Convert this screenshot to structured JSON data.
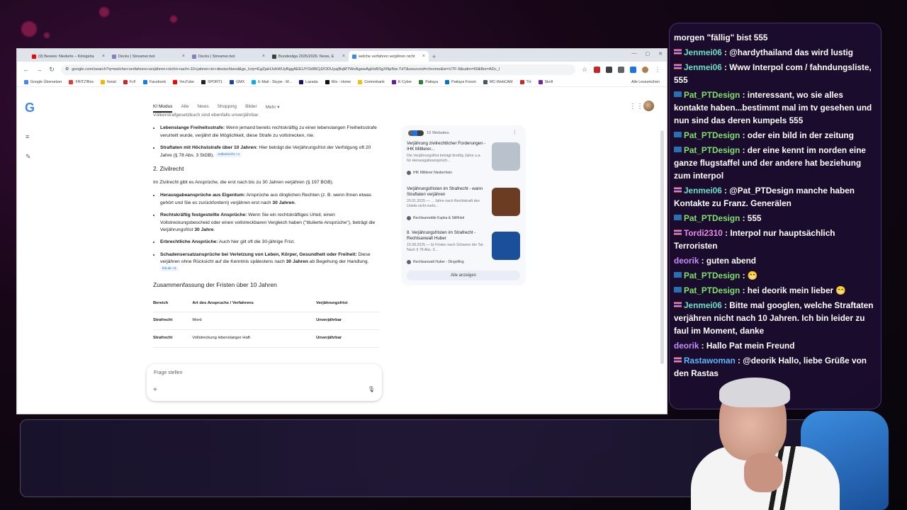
{
  "browser": {
    "tabs": [
      {
        "label": "(9) Beweis: Niederle – Königsha",
        "color": "#ff0000"
      },
      {
        "label": "Decks | Streamer.bot",
        "color": "#8e7cc3"
      },
      {
        "label": "Decks | Streamer.bot",
        "color": "#8e7cc3"
      },
      {
        "label": "Bundesliga 2025/2026: News, E",
        "color": "#3c4043"
      },
      {
        "label": "welche verfahren verjähren nicht",
        "color": "#4285f4"
      }
    ],
    "url": "google.com/search?q=welche+verfahren+verjähren+nicht+nach+10+jahren+in+deutschland&gs_lcrp=EgZjaHJvbWUyBggAEEUYOdIBCjI2ODUyajBqMTWoAgewAgHxBSgXNpNw-TdT&sourceid=chrome&ie=UTF-8&udm=50&fbs=ADc_l",
    "bookmarks": [
      {
        "label": "Google Übersetzer",
        "color": "#4285f4"
      },
      {
        "label": "FRITZ!Box",
        "color": "#e53935"
      },
      {
        "label": "fonial",
        "color": "#f4b400"
      },
      {
        "label": "FcF",
        "color": "#c62828"
      },
      {
        "label": "Facebook",
        "color": "#1877f2"
      },
      {
        "label": "YouTube",
        "color": "#ff0000"
      },
      {
        "label": "SPORT1",
        "color": "#222222"
      },
      {
        "label": "GMX",
        "color": "#1c449b"
      },
      {
        "label": "E-Mail - Skype - M...",
        "color": "#00aff0"
      },
      {
        "label": "Lazada",
        "color": "#0f146d"
      },
      {
        "label": "Wix - Home",
        "color": "#111111"
      },
      {
        "label": "Comonbank",
        "color": "#f6c000"
      },
      {
        "label": "K-Cyber",
        "color": "#6a1b9a"
      },
      {
        "label": "Pattaya",
        "color": "#2e7d32"
      },
      {
        "label": "Pattaya Forum",
        "color": "#0277bd"
      },
      {
        "label": "MC-WebCAM",
        "color": "#455a64"
      },
      {
        "label": "TH",
        "color": "#c62828"
      },
      {
        "label": "Skrill",
        "color": "#7b1fa2"
      }
    ],
    "bookmarks_all": "Alle Lesezeichen"
  },
  "google": {
    "logo": "G",
    "nav": [
      "KI Modus",
      "Alle",
      "News",
      "Shopping",
      "Bilder",
      "Mehr ▾"
    ],
    "top_fragment": "Völkerstrafgesetzbuch sind ebenfalls unverjährbar.",
    "criminal_items": [
      {
        "bold": "Lebenslange Freiheitsstrafe:",
        "text": " Wenn jemand bereits rechtskräftig zu einer lebenslangen Freiheitsstrafe verurteilt wurde, verjährt die Möglichkeit, diese Strafe zu vollstrecken, nie."
      },
      {
        "bold": "Straftaten mit Höchststrafe über 10 Jahren:",
        "text": " Hier beträgt die Verjährungsfrist der Verfolgung oft 20 Jahre (§ 78 Abs. 3 StGB).",
        "chip": "Artikelrecht +4"
      }
    ],
    "civil_heading": "2. Zivilrecht",
    "civil_intro": "Im Zivilrecht gibt es Ansprüche, die erst nach bis zu 30 Jahren verjähren (§ 197 BGB).",
    "civil_items": [
      {
        "bold": "Herausgabeansprüche aus Eigentum:",
        "text": " Ansprüche aus dinglichen Rechten (z. B. wenn Ihnen etwas gehört und Sie es zurückfordern) verjähren erst nach ",
        "bold2": "30 Jahren",
        "tail": "."
      },
      {
        "bold": "Rechtskräftig festgestellte Ansprüche:",
        "text": " Wenn Sie ein rechtskräftiges Urteil, einen Vollstreckungsbescheid oder einen vollstreckbaren Vergleich haben (\"titulierte Ansprüche\"), beträgt die Verjährungsfrist ",
        "bold2": "30 Jahre",
        "tail": "."
      },
      {
        "bold": "Erbrechtliche Ansprüche:",
        "text": " Auch hier gilt oft die 30-jährige Frist.",
        "bold2": "",
        "tail": ""
      },
      {
        "bold": "Schadensersatzansprüche bei Verletzung von Leben, Körper, Gesundheit oder Freiheit:",
        "text": " Diese verjähren ohne Rücksicht auf die Kenntnis spätestens nach ",
        "bold2": "30 Jahren",
        "tail": " ab Begehung der Handlung.",
        "chip": "ihk.de +3"
      }
    ],
    "summary_heading": "Zusammenfassung der Fristen über 10 Jahren",
    "table": {
      "headers": [
        "Bereich",
        "Art des Anspruchs / Verfahrens",
        "Verjährungsfrist"
      ],
      "rows": [
        [
          "Strafrecht",
          "Mord",
          "Unverjährbar"
        ],
        [
          "Strafrecht",
          "Vollstreckung lebenslanger Haft",
          "Unverjährbar"
        ]
      ]
    },
    "ask_placeholder": "Frage stellen",
    "sources": {
      "count_label": "15 Websites",
      "items": [
        {
          "title": "Verjährung zivilrechtlicher Forderungen - IHK Mittlerer...",
          "snippet": "Die Verjährungsfrist beträgt dreißig Jahre u.a. für Herausgabeansprüch...",
          "site": "IHK Mittlerer Niederrhein",
          "thumb": "#b9c2cc"
        },
        {
          "title": "Verjährungsfristen im Strafrecht - wann Straftaten verjähren",
          "snippet": "20.01.2025 — ... Jahre nach Rechtskraft des Urteils nicht mehr...",
          "site": "Rechtsanwälte Kupka & Stillfried",
          "thumb": "#6b3b22"
        },
        {
          "title": "8. Verjährungsfristen im Strafrecht - Rechtsanwalt Huber",
          "snippet": "15.08.2025 — b) Fristen nach Schwere der Tat. Nach § 78 Abs. 3...",
          "site": "Rechtsanwalt Huber - Dingolfing",
          "thumb": "#1a4f99"
        }
      ],
      "show_all": "Alle anzeigen"
    }
  },
  "chat": {
    "messages": [
      {
        "flag": "",
        "user": "",
        "text": "morgen \"fällig\" bist 555"
      },
      {
        "flag": "th",
        "user": "Jenmei06",
        "cls": "u-jen",
        "text": " : @hardythailand das wird lustig"
      },
      {
        "flag": "th",
        "user": "Jenmei06",
        "cls": "u-jen",
        "text": " : Www Interpol com / fahndungsliste, 555"
      },
      {
        "flag": "gr",
        "user": "Pat_PTDesign",
        "cls": "u-pat",
        "text": " : interessant, wo sie alles kontakte haben...bestimmt mal im tv gesehen und nun sind das deren kumpels 555"
      },
      {
        "flag": "gr",
        "user": "Pat_PTDesign",
        "cls": "u-pat",
        "text": " : oder ein bild in der zeitung"
      },
      {
        "flag": "gr",
        "user": "Pat_PTDesign",
        "cls": "u-pat",
        "text": " : der eine kennt im norden eine ganze flugstaffel und der andere hat beziehung zum interpol"
      },
      {
        "flag": "th",
        "user": "Jenmei06",
        "cls": "u-jen",
        "text": " : @Pat_PTDesign manche haben Kontakte zu Franz. Generälen"
      },
      {
        "flag": "gr",
        "user": "Pat_PTDesign",
        "cls": "u-pat",
        "text": " : 555"
      },
      {
        "flag": "th",
        "user": "Tordi2310",
        "cls": "u-tor",
        "text": " : Interpol nur hauptsächlich Terroristen"
      },
      {
        "flag": "",
        "user": "deorik",
        "cls": "u-deo",
        "text": " : guten abend"
      },
      {
        "flag": "gr",
        "user": "Pat_PTDesign",
        "cls": "u-pat",
        "text": " : 😁"
      },
      {
        "flag": "gr",
        "user": "Pat_PTDesign",
        "cls": "u-pat",
        "text": " : hei deorik mein lieber 😁"
      },
      {
        "flag": "th",
        "user": "Jenmei06",
        "cls": "u-jen",
        "text": " : Bitte mal googlen, welche Straftaten verjähren nicht nach 10 Jahren. Ich bin leider zu faul im Moment, danke"
      },
      {
        "flag": "",
        "user": "deorik",
        "cls": "u-deo",
        "text": " : Hallo Pat mein Freund"
      },
      {
        "flag": "th",
        "user": "Rastawoman",
        "cls": "u-ras",
        "text": " : @deorik Hallo, liebe Grüße von den Rastas"
      }
    ]
  }
}
